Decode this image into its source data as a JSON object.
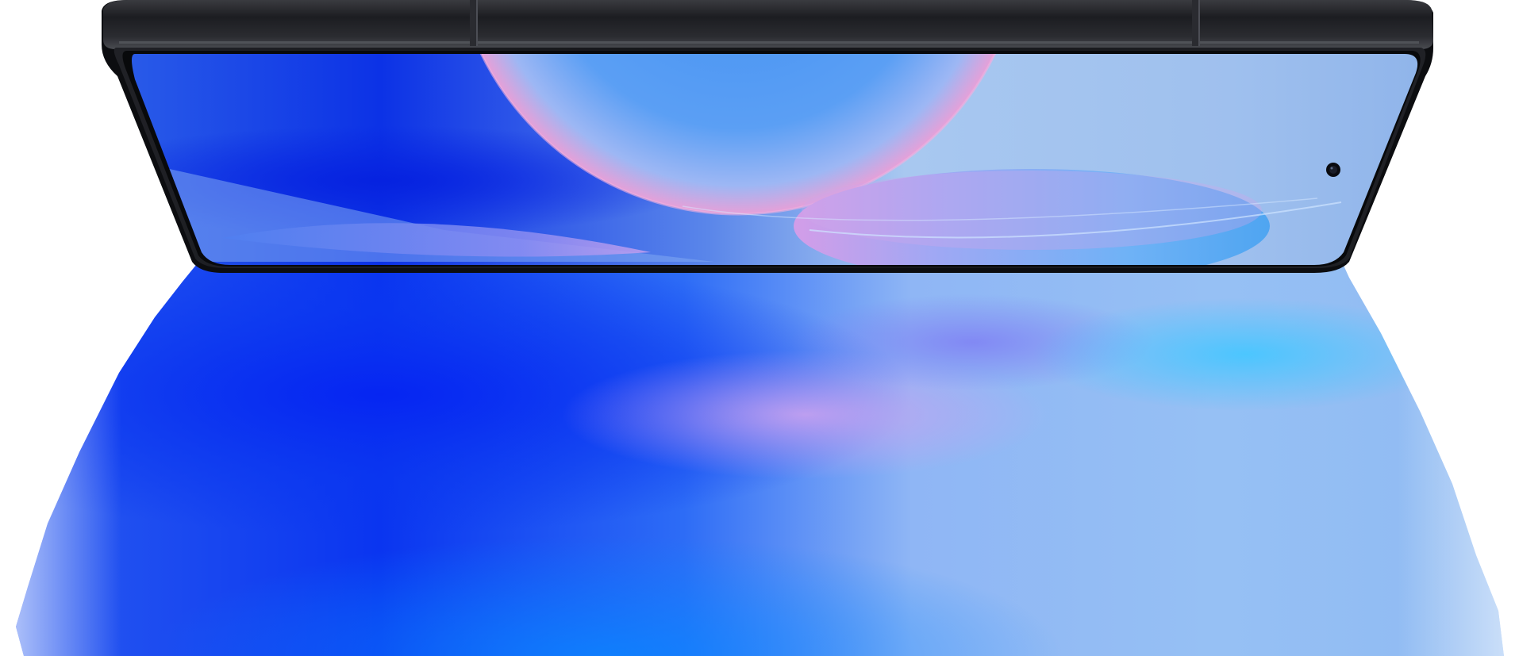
{
  "image": {
    "subject": "smartphone",
    "colors": {
      "frame": "#1c1d21",
      "frame_highlight": "#4a4c52",
      "bezel": "#08090b",
      "screen_deep_blue": "#0a2fe0",
      "screen_light_blue": "#a9c9f0",
      "accent_pink": "#e6a0d8",
      "reflection_blue": "#0a3cf5",
      "reflection_cyan": "#5cc3ff",
      "background": "#ffffff"
    }
  }
}
